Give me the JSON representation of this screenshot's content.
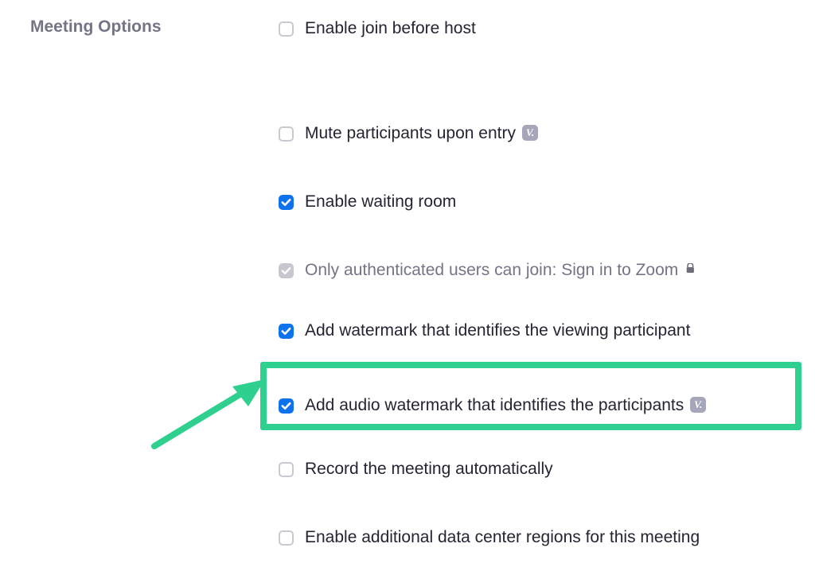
{
  "section_title": "Meeting Options",
  "options": [
    {
      "label": "Enable join before host",
      "state": "unchecked",
      "info": false,
      "lock": false
    },
    {
      "label": "Mute participants upon entry",
      "state": "unchecked",
      "info": true,
      "lock": false
    },
    {
      "label": "Enable waiting room",
      "state": "checked",
      "info": false,
      "lock": false
    },
    {
      "label": "Only authenticated users can join: Sign in to Zoom",
      "state": "locked-on",
      "info": false,
      "lock": true
    },
    {
      "label": "Add watermark that identifies the viewing participant",
      "state": "checked",
      "info": false,
      "lock": false
    },
    {
      "label": "Add audio watermark that identifies the participants",
      "state": "checked",
      "info": true,
      "lock": false
    },
    {
      "label": "Record the meeting automatically",
      "state": "unchecked",
      "info": false,
      "lock": false
    },
    {
      "label": "Enable additional data center regions for this meeting",
      "state": "unchecked",
      "info": false,
      "lock": false
    }
  ],
  "info_badge_text": "V.",
  "highlight": {
    "color": "#2ecf8f",
    "target_index": 5
  }
}
